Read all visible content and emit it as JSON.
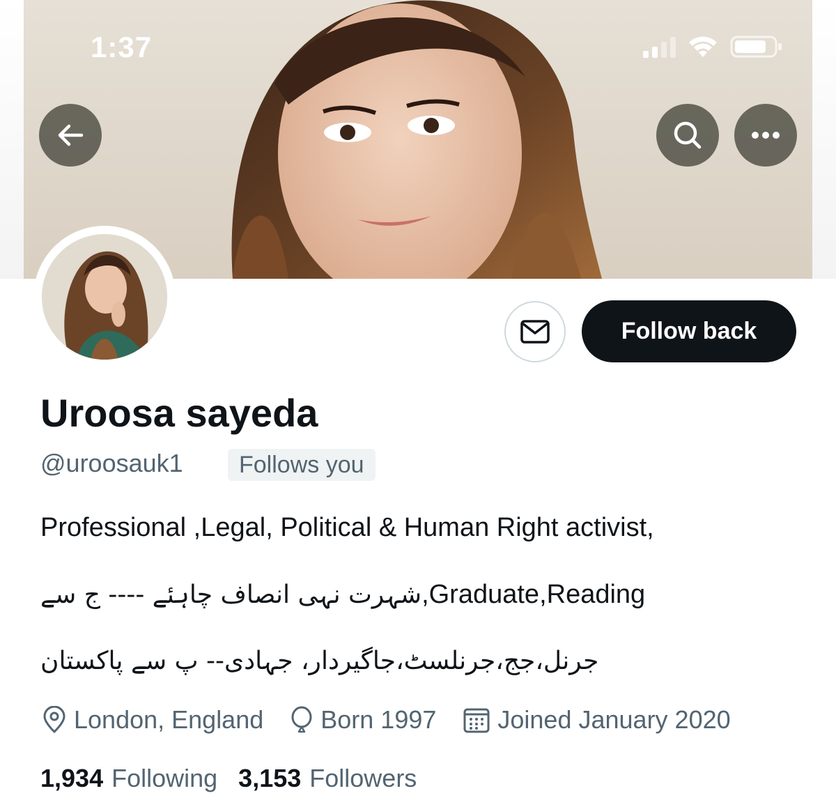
{
  "status_bar": {
    "time": "1:37"
  },
  "header": {
    "back_icon": "arrow-left-icon",
    "search_icon": "search-icon",
    "more_icon": "more-horizontal-icon"
  },
  "profile": {
    "display_name": "Uroosa sayeda",
    "handle": "@uroosauk1",
    "follows_you_label": "Follows you",
    "follow_button_label": "Follow back",
    "message_icon": "mail-icon",
    "bio": {
      "line1": "Professional ,Legal, Political & Human Right activist,",
      "line2_latin": "Graduate,Reading",
      "line2_urdu": "شہرت نہی انصاف چاہئے ---- ج سے",
      "line2_sep": ",",
      "line3_urdu": "جرنل،جج،جرنلسٹ،جاگیردار، جہادی-- پ سے پاکستان"
    },
    "location": "London, England",
    "birth": "Born 1997",
    "joined": "Joined January 2020",
    "following_count": "1,934",
    "following_label": "Following",
    "followers_count": "3,153",
    "followers_label": "Followers"
  },
  "colors": {
    "primary_text": "#0f1419",
    "secondary_text": "#536471",
    "follow_button_bg": "#0f1419",
    "badge_bg": "#eff3f4"
  }
}
